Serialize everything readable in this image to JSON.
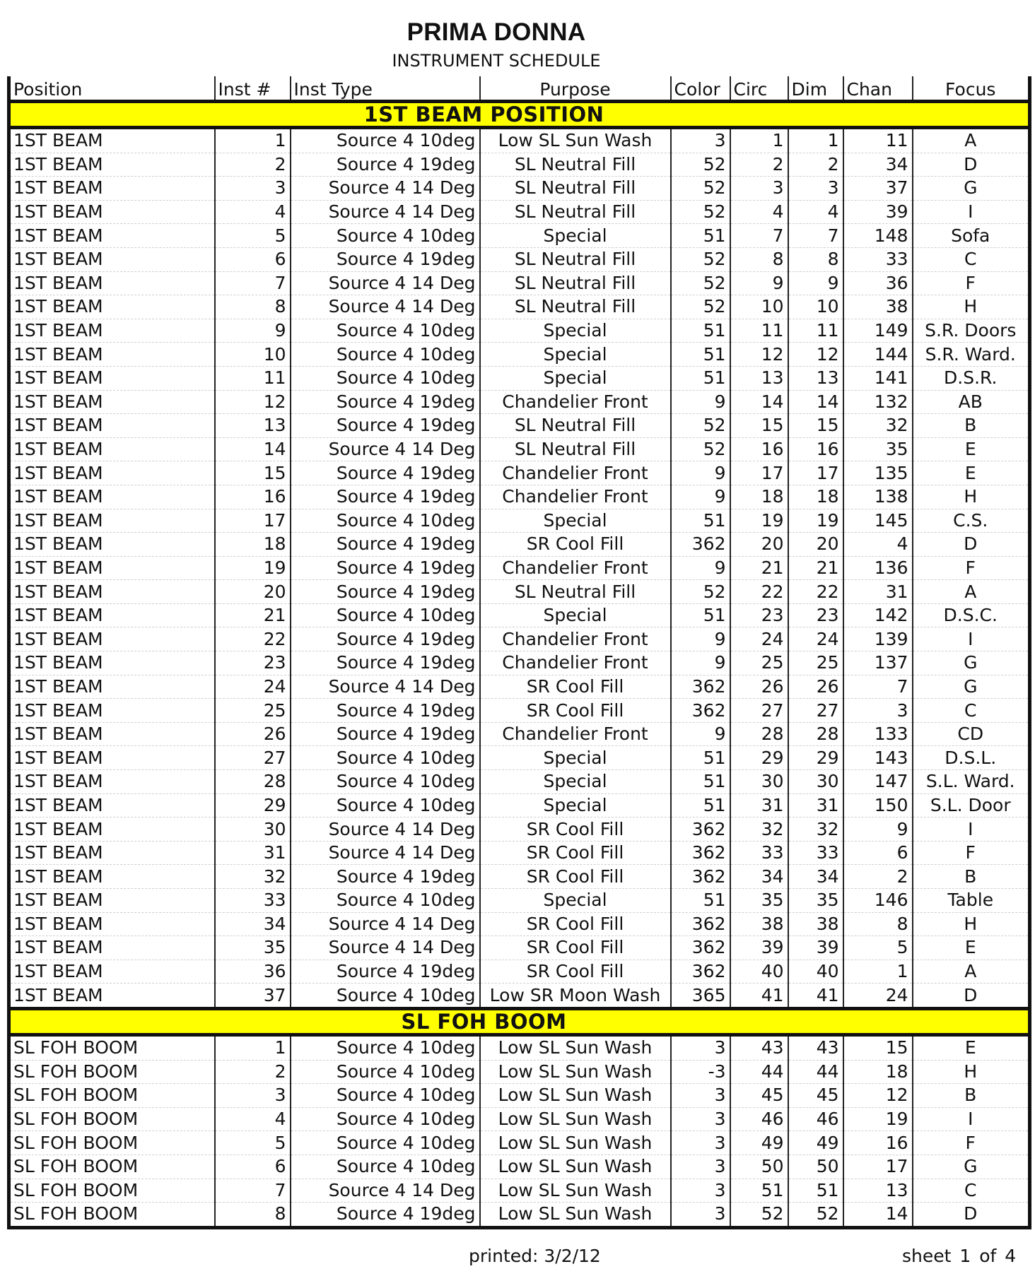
{
  "document": {
    "title": "PRIMA DONNA",
    "subtitle": "INSTRUMENT SCHEDULE"
  },
  "colors": {
    "section_band": "#ffff00",
    "rule": "#111111"
  },
  "columns": [
    "Position",
    "Inst #",
    "Inst Type",
    "Purpose",
    "Color",
    "Circ",
    "Dim",
    "Chan",
    "Focus"
  ],
  "sections": [
    {
      "heading": "1ST BEAM POSITION",
      "rows": [
        [
          "1ST BEAM",
          "1",
          "Source 4 10deg",
          "Low SL Sun Wash",
          "3",
          "1",
          "1",
          "11",
          "A"
        ],
        [
          "1ST BEAM",
          "2",
          "Source 4 19deg",
          "SL Neutral Fill",
          "52",
          "2",
          "2",
          "34",
          "D"
        ],
        [
          "1ST BEAM",
          "3",
          "Source 4 14 Deg",
          "SL Neutral Fill",
          "52",
          "3",
          "3",
          "37",
          "G"
        ],
        [
          "1ST BEAM",
          "4",
          "Source 4 14 Deg",
          "SL Neutral Fill",
          "52",
          "4",
          "4",
          "39",
          "I"
        ],
        [
          "1ST BEAM",
          "5",
          "Source 4 10deg",
          "Special",
          "51",
          "7",
          "7",
          "148",
          "Sofa"
        ],
        [
          "1ST BEAM",
          "6",
          "Source 4 19deg",
          "SL Neutral Fill",
          "52",
          "8",
          "8",
          "33",
          "C"
        ],
        [
          "1ST BEAM",
          "7",
          "Source 4 14 Deg",
          "SL Neutral Fill",
          "52",
          "9",
          "9",
          "36",
          "F"
        ],
        [
          "1ST BEAM",
          "8",
          "Source 4 14 Deg",
          "SL Neutral Fill",
          "52",
          "10",
          "10",
          "38",
          "H"
        ],
        [
          "1ST BEAM",
          "9",
          "Source 4 10deg",
          "Special",
          "51",
          "11",
          "11",
          "149",
          "S.R. Doors"
        ],
        [
          "1ST BEAM",
          "10",
          "Source 4 10deg",
          "Special",
          "51",
          "12",
          "12",
          "144",
          "S.R. Ward."
        ],
        [
          "1ST BEAM",
          "11",
          "Source 4 10deg",
          "Special",
          "51",
          "13",
          "13",
          "141",
          "D.S.R."
        ],
        [
          "1ST BEAM",
          "12",
          "Source 4 19deg",
          "Chandelier Front",
          "9",
          "14",
          "14",
          "132",
          "AB"
        ],
        [
          "1ST BEAM",
          "13",
          "Source 4 19deg",
          "SL Neutral Fill",
          "52",
          "15",
          "15",
          "32",
          "B"
        ],
        [
          "1ST BEAM",
          "14",
          "Source 4 14 Deg",
          "SL Neutral Fill",
          "52",
          "16",
          "16",
          "35",
          "E"
        ],
        [
          "1ST BEAM",
          "15",
          "Source 4 19deg",
          "Chandelier Front",
          "9",
          "17",
          "17",
          "135",
          "E"
        ],
        [
          "1ST BEAM",
          "16",
          "Source 4 19deg",
          "Chandelier Front",
          "9",
          "18",
          "18",
          "138",
          "H"
        ],
        [
          "1ST BEAM",
          "17",
          "Source 4 10deg",
          "Special",
          "51",
          "19",
          "19",
          "145",
          "C.S."
        ],
        [
          "1ST BEAM",
          "18",
          "Source 4 19deg",
          "SR Cool Fill",
          "362",
          "20",
          "20",
          "4",
          "D"
        ],
        [
          "1ST BEAM",
          "19",
          "Source 4 19deg",
          "Chandelier Front",
          "9",
          "21",
          "21",
          "136",
          "F"
        ],
        [
          "1ST BEAM",
          "20",
          "Source 4 19deg",
          "SL Neutral Fill",
          "52",
          "22",
          "22",
          "31",
          "A"
        ],
        [
          "1ST BEAM",
          "21",
          "Source 4 10deg",
          "Special",
          "51",
          "23",
          "23",
          "142",
          "D.S.C."
        ],
        [
          "1ST BEAM",
          "22",
          "Source 4 19deg",
          "Chandelier Front",
          "9",
          "24",
          "24",
          "139",
          "I"
        ],
        [
          "1ST BEAM",
          "23",
          "Source 4 19deg",
          "Chandelier Front",
          "9",
          "25",
          "25",
          "137",
          "G"
        ],
        [
          "1ST BEAM",
          "24",
          "Source 4 14 Deg",
          "SR Cool Fill",
          "362",
          "26",
          "26",
          "7",
          "G"
        ],
        [
          "1ST BEAM",
          "25",
          "Source 4 19deg",
          "SR Cool Fill",
          "362",
          "27",
          "27",
          "3",
          "C"
        ],
        [
          "1ST BEAM",
          "26",
          "Source 4 19deg",
          "Chandelier Front",
          "9",
          "28",
          "28",
          "133",
          "CD"
        ],
        [
          "1ST BEAM",
          "27",
          "Source 4 10deg",
          "Special",
          "51",
          "29",
          "29",
          "143",
          "D.S.L."
        ],
        [
          "1ST BEAM",
          "28",
          "Source 4 10deg",
          "Special",
          "51",
          "30",
          "30",
          "147",
          "S.L. Ward."
        ],
        [
          "1ST BEAM",
          "29",
          "Source 4 10deg",
          "Special",
          "51",
          "31",
          "31",
          "150",
          "S.L. Door"
        ],
        [
          "1ST BEAM",
          "30",
          "Source 4 14 Deg",
          "SR Cool Fill",
          "362",
          "32",
          "32",
          "9",
          "I"
        ],
        [
          "1ST BEAM",
          "31",
          "Source 4 14 Deg",
          "SR Cool Fill",
          "362",
          "33",
          "33",
          "6",
          "F"
        ],
        [
          "1ST BEAM",
          "32",
          "Source 4 19deg",
          "SR Cool Fill",
          "362",
          "34",
          "34",
          "2",
          "B"
        ],
        [
          "1ST BEAM",
          "33",
          "Source 4 10deg",
          "Special",
          "51",
          "35",
          "35",
          "146",
          "Table"
        ],
        [
          "1ST BEAM",
          "34",
          "Source 4 14 Deg",
          "SR Cool Fill",
          "362",
          "38",
          "38",
          "8",
          "H"
        ],
        [
          "1ST BEAM",
          "35",
          "Source 4 14 Deg",
          "SR Cool Fill",
          "362",
          "39",
          "39",
          "5",
          "E"
        ],
        [
          "1ST BEAM",
          "36",
          "Source 4 19deg",
          "SR Cool Fill",
          "362",
          "40",
          "40",
          "1",
          "A"
        ],
        [
          "1ST BEAM",
          "37",
          "Source 4 10deg",
          "Low SR Moon Wash",
          "365",
          "41",
          "41",
          "24",
          "D"
        ]
      ]
    },
    {
      "heading": "SL FOH BOOM",
      "rows": [
        [
          "SL FOH BOOM",
          "1",
          "Source 4 10deg",
          "Low SL Sun Wash",
          "3",
          "43",
          "43",
          "15",
          "E"
        ],
        [
          "SL FOH BOOM",
          "2",
          "Source 4 10deg",
          "Low SL Sun Wash",
          "-3",
          "44",
          "44",
          "18",
          "H"
        ],
        [
          "SL FOH BOOM",
          "3",
          "Source 4 10deg",
          "Low SL Sun Wash",
          "3",
          "45",
          "45",
          "12",
          "B"
        ],
        [
          "SL FOH BOOM",
          "4",
          "Source 4 10deg",
          "Low SL Sun Wash",
          "3",
          "46",
          "46",
          "19",
          "I"
        ],
        [
          "SL FOH BOOM",
          "5",
          "Source 4 10deg",
          "Low SL Sun Wash",
          "3",
          "49",
          "49",
          "16",
          "F"
        ],
        [
          "SL FOH BOOM",
          "6",
          "Source 4 10deg",
          "Low SL Sun Wash",
          "3",
          "50",
          "50",
          "17",
          "G"
        ],
        [
          "SL FOH BOOM",
          "7",
          "Source 4 14 Deg",
          "Low SL Sun Wash",
          "3",
          "51",
          "51",
          "13",
          "C"
        ],
        [
          "SL FOH BOOM",
          "8",
          "Source 4 19deg",
          "Low SL Sun Wash",
          "3",
          "52",
          "52",
          "14",
          "D"
        ]
      ]
    }
  ],
  "footer": {
    "printed": "printed: 3/2/12",
    "sheet": "sheet 1  of 4"
  }
}
